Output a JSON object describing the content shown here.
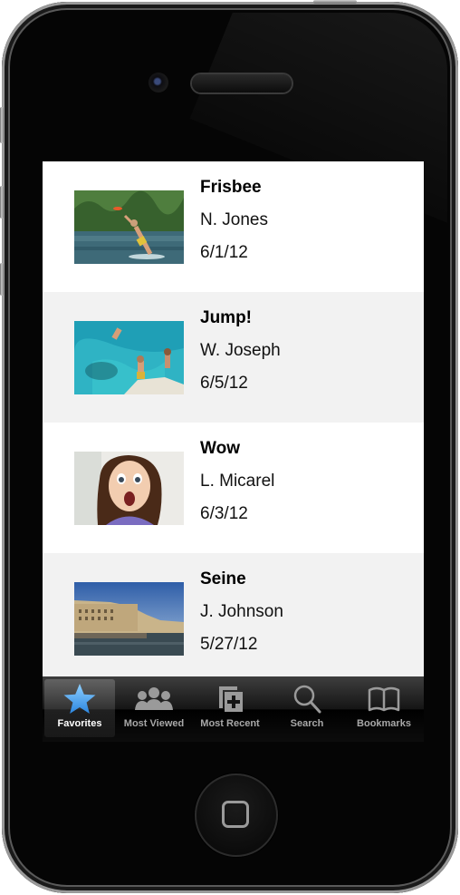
{
  "items": [
    {
      "title": "Frisbee",
      "author": "N. Jones",
      "date": "6/1/12"
    },
    {
      "title": "Jump!",
      "author": "W. Joseph",
      "date": "6/5/12"
    },
    {
      "title": "Wow",
      "author": "L. Micarel",
      "date": "6/3/12"
    },
    {
      "title": "Seine",
      "author": "J. Johnson",
      "date": "5/27/12"
    }
  ],
  "tabs": [
    {
      "label": "Favorites",
      "icon": "star-icon",
      "selected": true
    },
    {
      "label": "Most Viewed",
      "icon": "people-icon",
      "selected": false
    },
    {
      "label": "Most Recent",
      "icon": "add-document-icon",
      "selected": false
    },
    {
      "label": "Search",
      "icon": "search-icon",
      "selected": false
    },
    {
      "label": "Bookmarks",
      "icon": "book-icon",
      "selected": false
    }
  ],
  "colors": {
    "active_tab_icon": "#3f9ef0",
    "inactive_tab_icon": "#9a9a9a",
    "row_alt_background": "#f2f2f2"
  }
}
